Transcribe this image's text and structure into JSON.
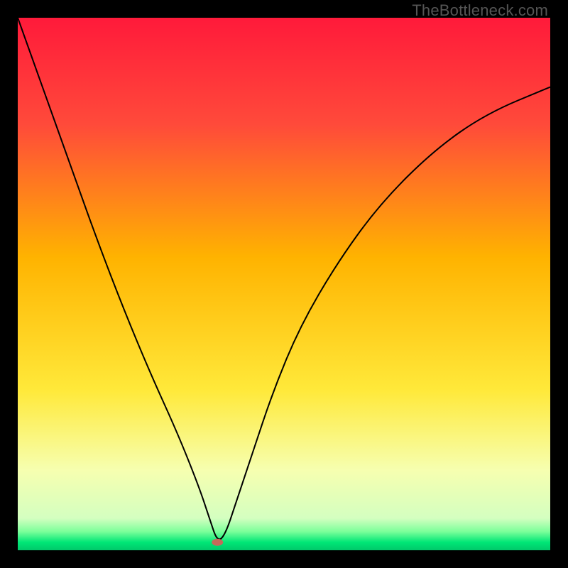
{
  "watermark": "TheBottleneck.com",
  "chart_data": {
    "type": "line",
    "title": "",
    "xlabel": "",
    "ylabel": "",
    "xlim": [
      0,
      100
    ],
    "ylim": [
      0,
      100
    ],
    "grid": false,
    "legend": false,
    "gradient_stops": [
      {
        "offset": 0.0,
        "color": "#ff1a3a"
      },
      {
        "offset": 0.2,
        "color": "#ff4a3a"
      },
      {
        "offset": 0.45,
        "color": "#ffb300"
      },
      {
        "offset": 0.7,
        "color": "#ffe93a"
      },
      {
        "offset": 0.85,
        "color": "#f6ffb0"
      },
      {
        "offset": 0.94,
        "color": "#d4ffc0"
      },
      {
        "offset": 0.965,
        "color": "#7bff9a"
      },
      {
        "offset": 0.985,
        "color": "#00e676"
      },
      {
        "offset": 1.0,
        "color": "#00c86a"
      }
    ],
    "series": [
      {
        "name": "bottleneck-curve",
        "color": "#000000",
        "width": 2,
        "x": [
          0,
          5,
          10,
          15,
          20,
          25,
          30,
          34,
          36,
          37.5,
          39,
          41,
          44,
          48,
          53,
          60,
          68,
          78,
          88,
          100
        ],
        "y": [
          100,
          86,
          72,
          58,
          45,
          33,
          22,
          12,
          6,
          1.5,
          3,
          9,
          18,
          30,
          42,
          54,
          65,
          75,
          82,
          87
        ]
      }
    ],
    "marker": {
      "name": "optimal-point",
      "x": 37.5,
      "y": 1.5,
      "rx": 8,
      "ry": 5,
      "fill": "#c46a5a"
    }
  }
}
